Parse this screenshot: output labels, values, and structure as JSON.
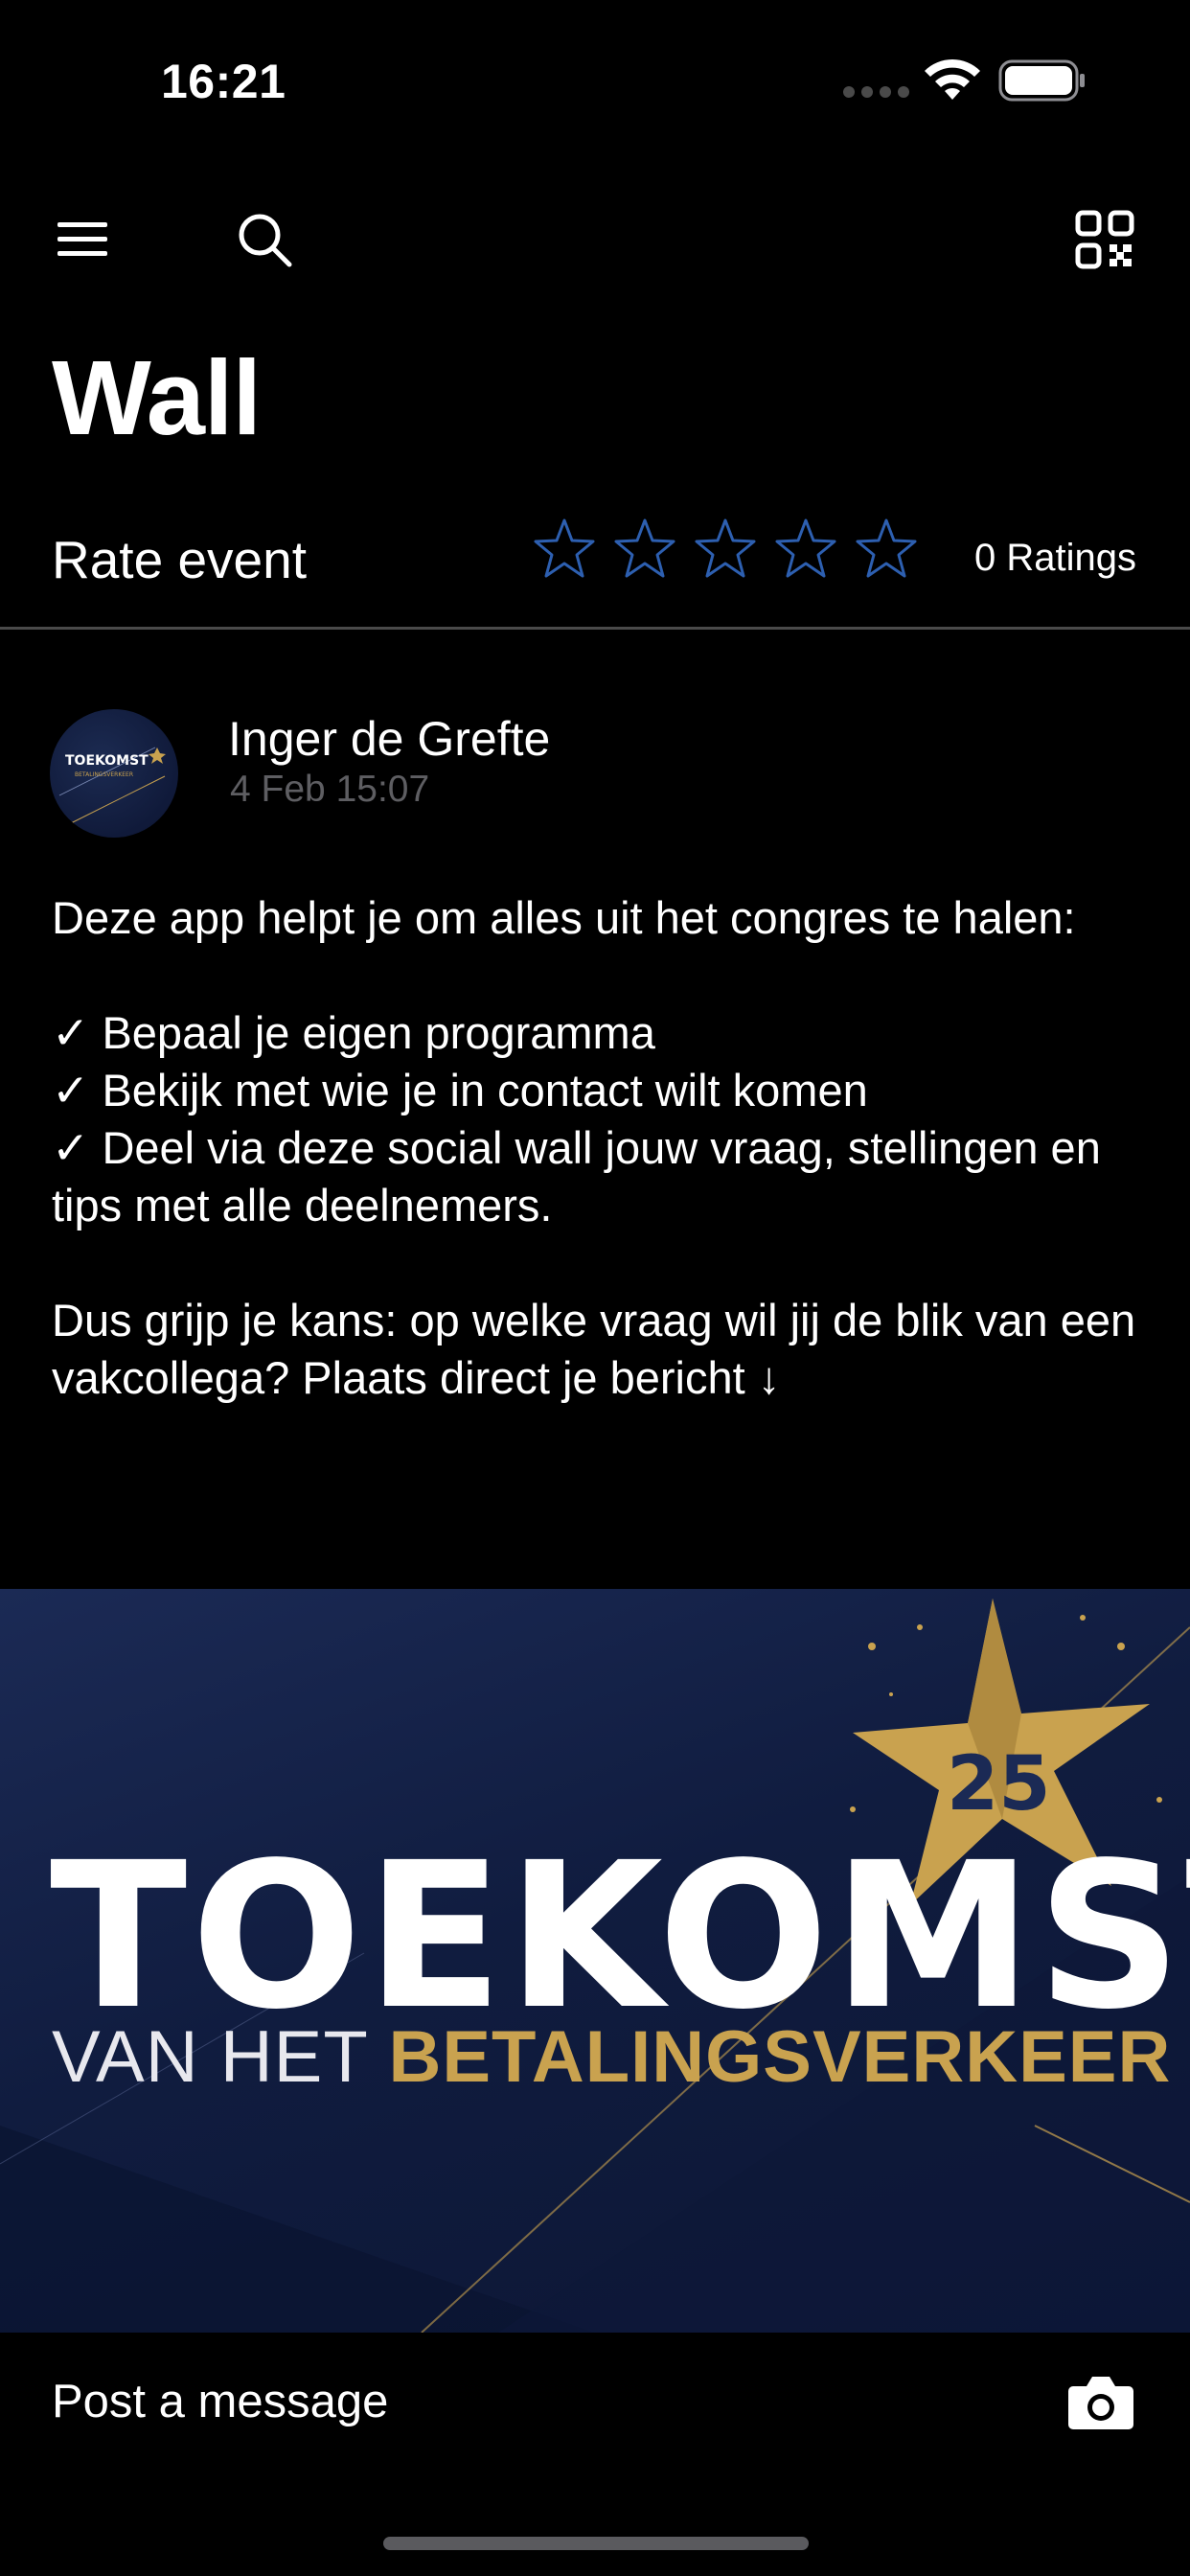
{
  "status_bar": {
    "time": "16:21"
  },
  "nav": {
    "menu_icon": "hamburger-menu-icon",
    "search_icon": "search-icon",
    "qr_icon": "qr-code-icon"
  },
  "page": {
    "title": "Wall"
  },
  "rating": {
    "label": "Rate event",
    "stars_total": 5,
    "stars_filled": 0,
    "count_text": "0 Ratings",
    "star_color": "#2d5fb0"
  },
  "post": {
    "author": "Inger de Grefte",
    "timestamp": "4 Feb 15:07",
    "avatar_text": "TOEKOMST",
    "paragraph1": "Deze app helpt je om alles uit het congres te halen:",
    "list": [
      "✓ Bepaal je eigen programma",
      "✓ Bekijk met wie je in contact wilt komen",
      "✓ Deel via deze social wall jouw vraag, stellingen en tips met alle deelnemers."
    ],
    "paragraph2": "Dus grijp je kans: op welke vraag wil jij de blik van een vakcollega? Plaats direct je bericht ↓"
  },
  "banner": {
    "word": "TOEKOMST",
    "sub_light": "VAN HET ",
    "sub_gold": "BETALINGSVERKEER",
    "badge_number": "25",
    "gold_color": "#c9a24f"
  },
  "composer": {
    "placeholder": "Post a message",
    "camera_icon": "camera-icon"
  }
}
